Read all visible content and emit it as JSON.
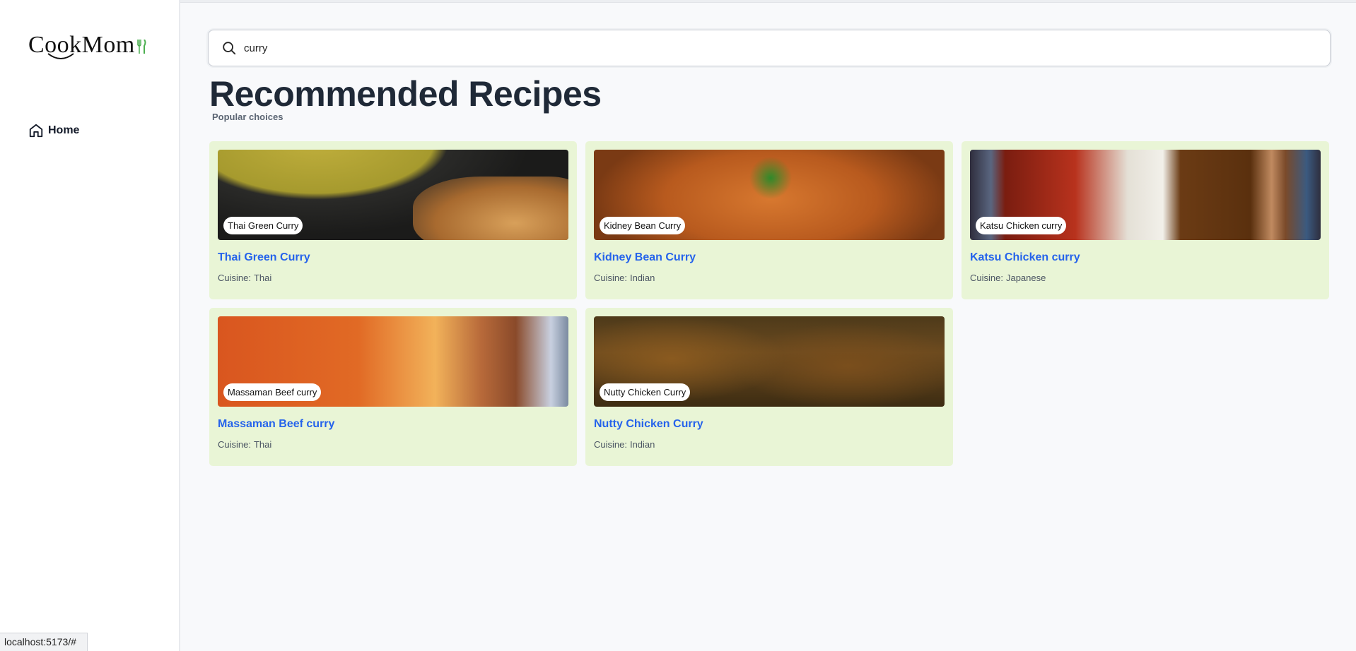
{
  "sidebar": {
    "logo_text": "CookMom",
    "nav": [
      {
        "label": "Home",
        "icon": "home-icon"
      }
    ]
  },
  "search": {
    "value": "curry",
    "icon": "search-icon"
  },
  "header": {
    "title": "Recommended Recipes",
    "subtitle": "Popular choices"
  },
  "recipes": [
    {
      "tag": "Thai Green Curry",
      "title": "Thai Green Curry",
      "cuisine_label": "Cuisine:",
      "cuisine": "Thai"
    },
    {
      "tag": "Kidney Bean Curry",
      "title": "Kidney Bean Curry",
      "cuisine_label": "Cuisine:",
      "cuisine": "Indian"
    },
    {
      "tag": "Katsu Chicken curry",
      "title": "Katsu Chicken curry",
      "cuisine_label": "Cuisine:",
      "cuisine": "Japanese"
    },
    {
      "tag": "Massaman Beef curry",
      "title": "Massaman Beef curry",
      "cuisine_label": "Cuisine:",
      "cuisine": "Thai"
    },
    {
      "tag": "Nutty Chicken Curry",
      "title": "Nutty Chicken Curry",
      "cuisine_label": "Cuisine:",
      "cuisine": "Indian"
    }
  ],
  "status_bar": {
    "url": "localhost:5173/#"
  },
  "colors": {
    "card_bg": "#e9f5d6",
    "link": "#2563eb",
    "logo_accent": "#4caf50"
  }
}
